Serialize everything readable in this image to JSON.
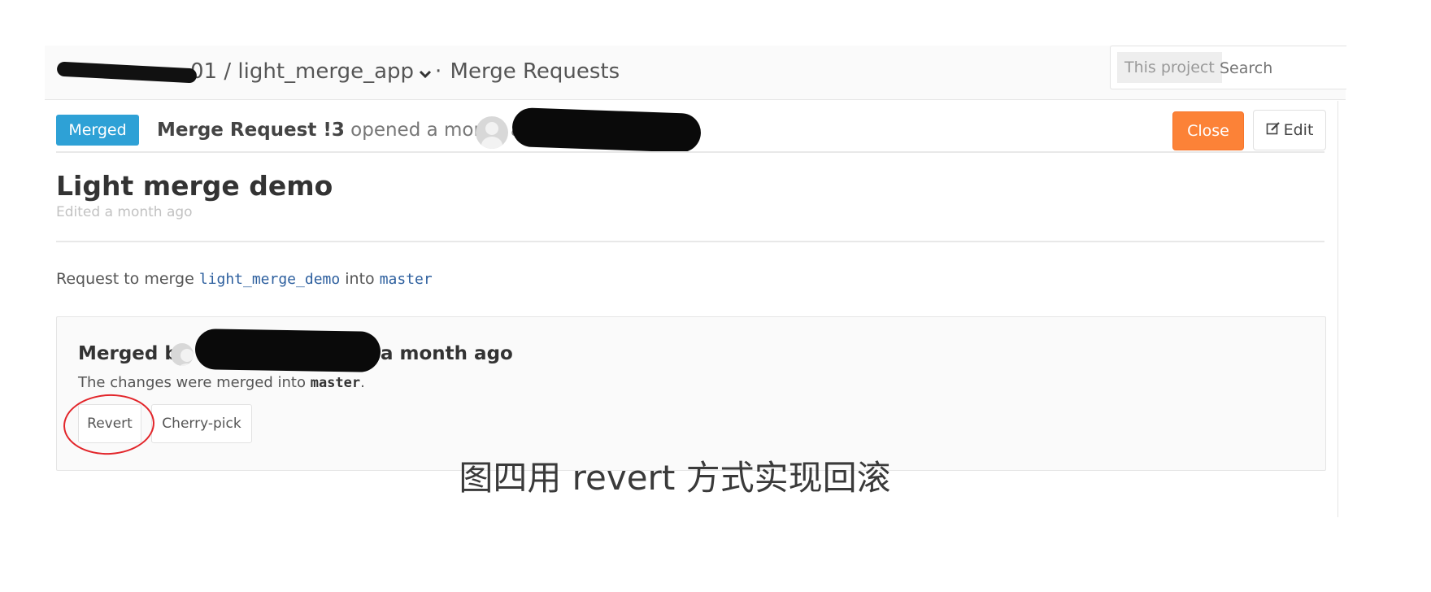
{
  "topbar": {
    "breadcrumb_namespace": "01",
    "separator": "/",
    "project": "light_merge_app",
    "dot": "·",
    "section": "Merge Requests"
  },
  "search": {
    "scope_label": "This project",
    "placeholder": "Search"
  },
  "header": {
    "status_badge": "Merged",
    "mr_label": "Merge Request !3",
    "opened_text": "opened a month ago by",
    "close_button": "Close",
    "edit_button": "Edit"
  },
  "title": {
    "text": "Light merge demo",
    "edited": "Edited a month ago"
  },
  "request": {
    "prefix": "Request to merge",
    "source_branch": "light_merge_demo",
    "middle": "into",
    "target_branch": "master"
  },
  "merge_panel": {
    "merged_by_label": "Merged by",
    "merged_time": "a month ago",
    "changes_prefix": "The changes were merged into",
    "changes_branch": "master",
    "changes_suffix": ".",
    "revert_button": "Revert",
    "cherry_pick_button": "Cherry-pick"
  },
  "caption": "图四用 revert 方式实现回滚",
  "colors": {
    "badge_blue": "#2ea1d6",
    "close_orange": "#fc8237",
    "branch_blue": "#2d5f9e",
    "highlight_red": "#e2252a"
  }
}
